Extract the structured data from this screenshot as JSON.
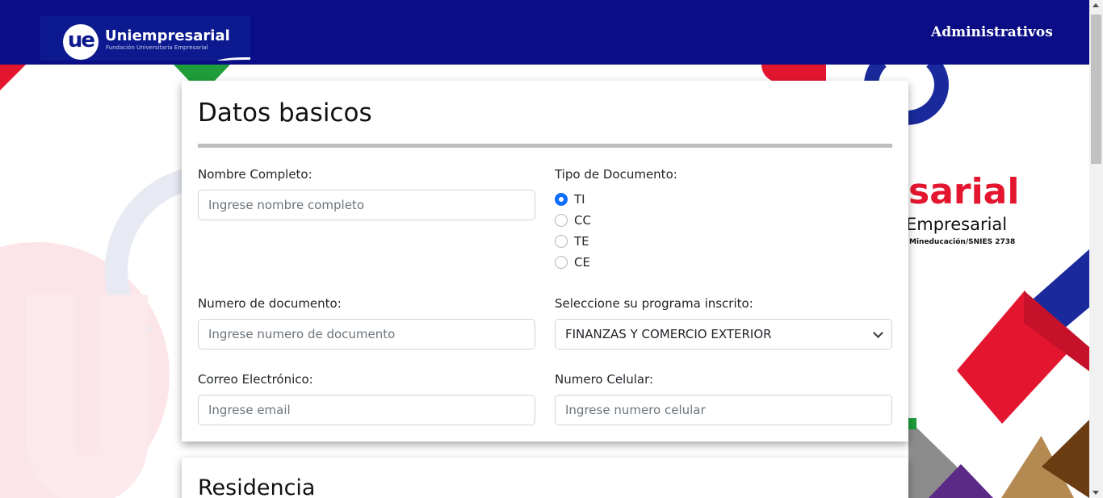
{
  "navbar": {
    "logo_name": "Uniempresarial",
    "logo_subtitle": "Fundación Universitaria Empresarial",
    "logo_mark": "ue",
    "nav_link": "Administrativos"
  },
  "background": {
    "brand_word": "sarial",
    "brand_sub": "Empresarial",
    "brand_note": "Mineducación/SNIES 2738"
  },
  "basic_data": {
    "title": "Datos basicos",
    "full_name": {
      "label": "Nombre Completo:",
      "placeholder": "Ingrese nombre completo",
      "value": ""
    },
    "doc_type": {
      "label": "Tipo de Documento:",
      "options": [
        "TI",
        "CC",
        "TE",
        "CE"
      ],
      "selected": "TI"
    },
    "doc_number": {
      "label": "Numero de documento:",
      "placeholder": "Ingrese numero de documento",
      "value": ""
    },
    "program": {
      "label": "Seleccione su programa inscrito:",
      "selected": "FINANZAS Y COMERCIO EXTERIOR"
    },
    "email": {
      "label": "Correo Electrónico:",
      "placeholder": "Ingrese email",
      "value": ""
    },
    "phone": {
      "label": "Numero Celular:",
      "placeholder": "Ingrese numero celular",
      "value": ""
    }
  },
  "residence": {
    "title": "Residencia"
  },
  "colors": {
    "navbar": "#0a0d85",
    "primary": "#0d6efd",
    "brand_red": "#e4162f",
    "brand_blue": "#1a2a9c"
  }
}
